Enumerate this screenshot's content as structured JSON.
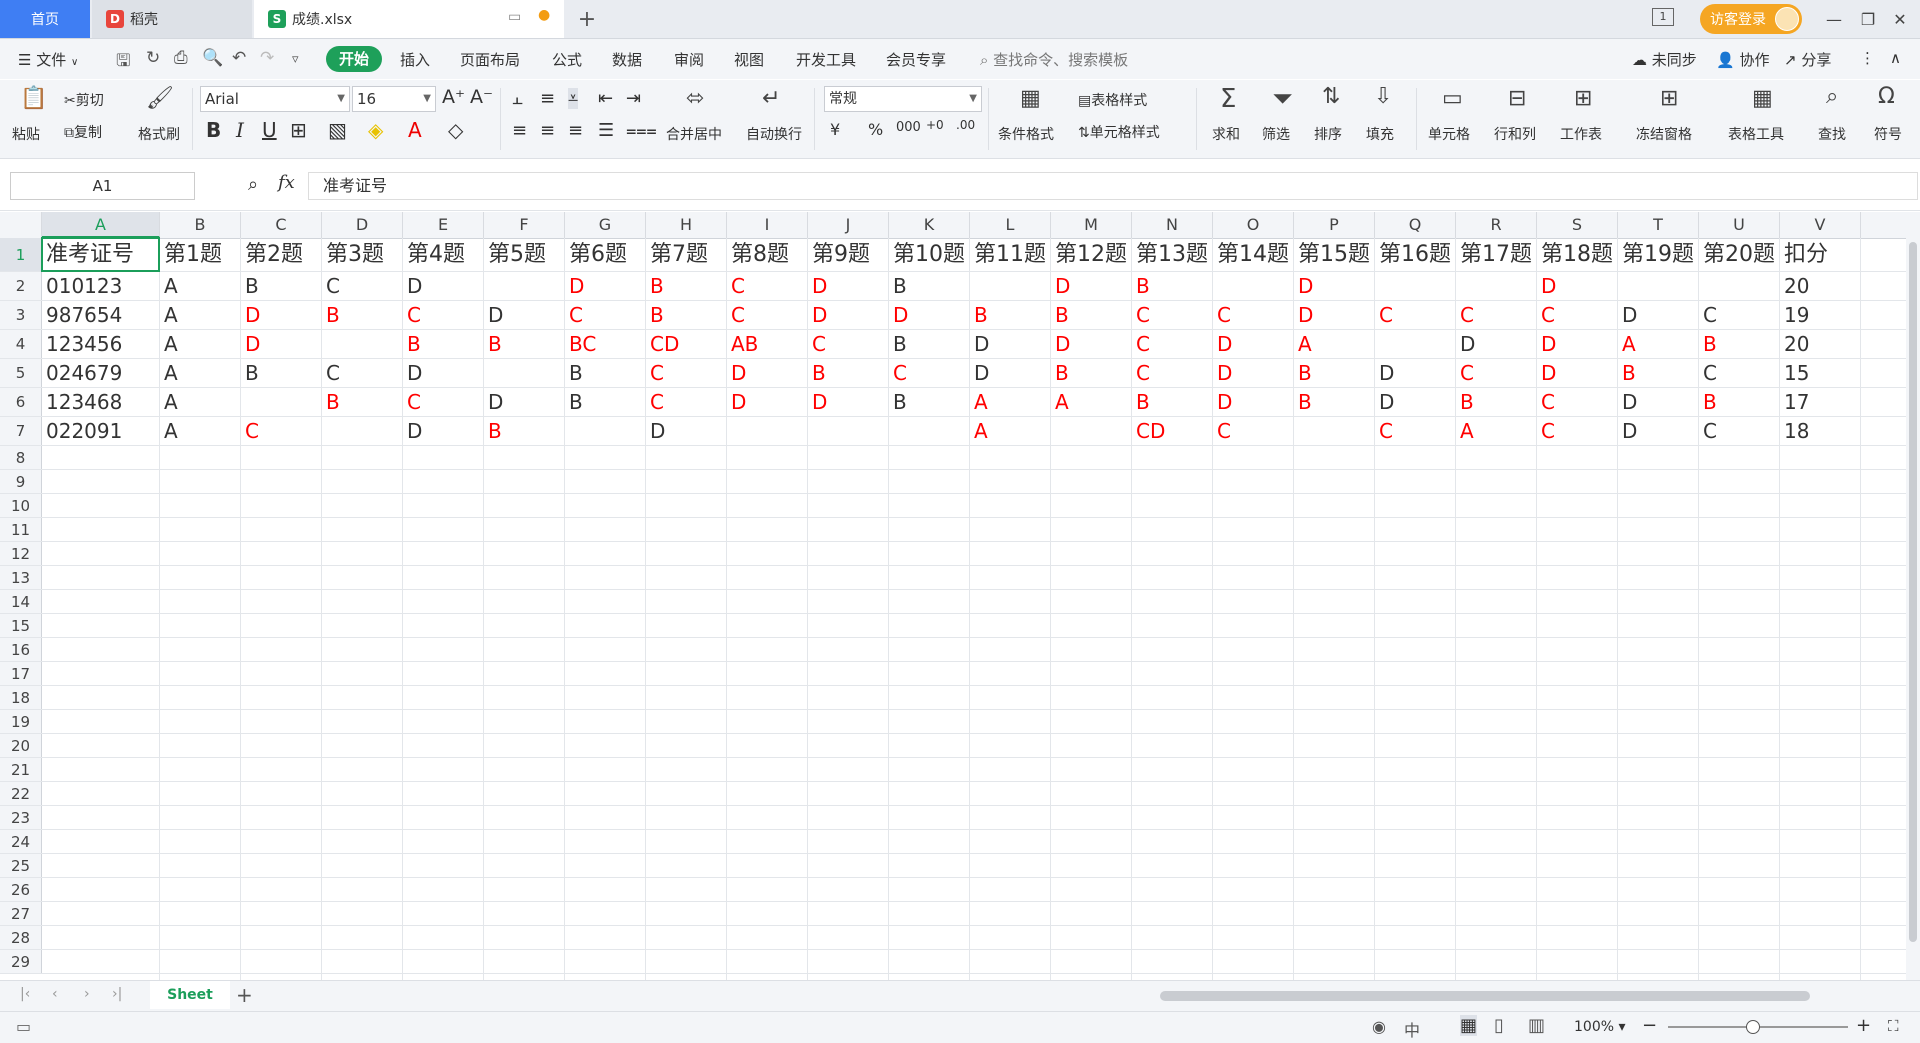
{
  "titlebar": {
    "tabs": [
      {
        "label": "首页"
      },
      {
        "label": "稻壳"
      },
      {
        "label": "成绩.xlsx"
      }
    ],
    "login": "访客登录",
    "page_indicator": "1"
  },
  "menubar": {
    "file": "文件",
    "items": [
      "开始",
      "插入",
      "页面布局",
      "公式",
      "数据",
      "审阅",
      "视图",
      "开发工具",
      "会员专享"
    ],
    "search_placeholder": "查找命令、搜索模板",
    "sync": "未同步",
    "collab": "协作",
    "share": "分享"
  },
  "toolbar": {
    "paste": "粘贴",
    "cut": "剪切",
    "copy": "复制",
    "format_painter": "格式刷",
    "font": "Arial",
    "size": "16",
    "merge_center": "合并居中",
    "wrap": "自动换行",
    "number_format": "常规",
    "cond_format": "条件格式",
    "table_style": "表格样式",
    "cell_style": "单元格样式",
    "sum": "求和",
    "filter": "筛选",
    "sort": "排序",
    "fill": "填充",
    "cell": "单元格",
    "rowcol": "行和列",
    "worksheet": "工作表",
    "freeze": "冻结窗格",
    "table_tools": "表格工具",
    "find": "查找",
    "symbol": "符号"
  },
  "formula_bar": {
    "name_box": "A1",
    "content": "准考证号"
  },
  "columns": [
    "A",
    "B",
    "C",
    "D",
    "E",
    "F",
    "G",
    "H",
    "I",
    "J",
    "K",
    "L",
    "M",
    "N",
    "O",
    "P",
    "Q",
    "R",
    "S",
    "T",
    "U",
    "V"
  ],
  "sheet": {
    "header": [
      "准考证号",
      "第1题",
      "第2题",
      "第3题",
      "第4题",
      "第5题",
      "第6题",
      "第7题",
      "第8题",
      "第9题",
      "第10题",
      "第11题",
      "第12题",
      "第13题",
      "第14题",
      "第15题",
      "第16题",
      "第17题",
      "第18题",
      "第19题",
      "第20题",
      "扣分"
    ],
    "rows": [
      [
        {
          "v": "010123"
        },
        {
          "v": "A"
        },
        {
          "v": "B"
        },
        {
          "v": "C"
        },
        {
          "v": "D"
        },
        {
          "v": ""
        },
        {
          "v": "D",
          "r": 1
        },
        {
          "v": "B",
          "r": 1
        },
        {
          "v": "C",
          "r": 1
        },
        {
          "v": "D",
          "r": 1
        },
        {
          "v": "B"
        },
        {
          "v": ""
        },
        {
          "v": "D",
          "r": 1
        },
        {
          "v": "B",
          "r": 1
        },
        {
          "v": ""
        },
        {
          "v": "D",
          "r": 1
        },
        {
          "v": ""
        },
        {
          "v": ""
        },
        {
          "v": "D",
          "r": 1
        },
        {
          "v": ""
        },
        {
          "v": ""
        },
        {
          "v": "20"
        }
      ],
      [
        {
          "v": "987654"
        },
        {
          "v": "A"
        },
        {
          "v": "D",
          "r": 1
        },
        {
          "v": "B",
          "r": 1
        },
        {
          "v": "C",
          "r": 1
        },
        {
          "v": "D"
        },
        {
          "v": "C",
          "r": 1
        },
        {
          "v": "B",
          "r": 1
        },
        {
          "v": "C",
          "r": 1
        },
        {
          "v": "D",
          "r": 1
        },
        {
          "v": "D",
          "r": 1
        },
        {
          "v": "B",
          "r": 1
        },
        {
          "v": "B",
          "r": 1
        },
        {
          "v": "C",
          "r": 1
        },
        {
          "v": "C",
          "r": 1
        },
        {
          "v": "D",
          "r": 1
        },
        {
          "v": "C",
          "r": 1
        },
        {
          "v": "C",
          "r": 1
        },
        {
          "v": "C",
          "r": 1
        },
        {
          "v": "D"
        },
        {
          "v": "C"
        },
        {
          "v": "19"
        }
      ],
      [
        {
          "v": "123456"
        },
        {
          "v": "A"
        },
        {
          "v": "D",
          "r": 1
        },
        {
          "v": ""
        },
        {
          "v": "B",
          "r": 1
        },
        {
          "v": "B",
          "r": 1
        },
        {
          "v": "BC",
          "r": 1
        },
        {
          "v": "CD",
          "r": 1
        },
        {
          "v": "AB",
          "r": 1
        },
        {
          "v": "C",
          "r": 1
        },
        {
          "v": "B"
        },
        {
          "v": "D"
        },
        {
          "v": "D",
          "r": 1
        },
        {
          "v": "C",
          "r": 1
        },
        {
          "v": "D",
          "r": 1
        },
        {
          "v": "A",
          "r": 1
        },
        {
          "v": ""
        },
        {
          "v": "D"
        },
        {
          "v": "D",
          "r": 1
        },
        {
          "v": "A",
          "r": 1
        },
        {
          "v": "B",
          "r": 1
        },
        {
          "v": "20"
        }
      ],
      [
        {
          "v": "024679"
        },
        {
          "v": "A"
        },
        {
          "v": "B"
        },
        {
          "v": "C"
        },
        {
          "v": "D"
        },
        {
          "v": ""
        },
        {
          "v": "B"
        },
        {
          "v": "C",
          "r": 1
        },
        {
          "v": "D",
          "r": 1
        },
        {
          "v": "B",
          "r": 1
        },
        {
          "v": "C",
          "r": 1
        },
        {
          "v": "D"
        },
        {
          "v": "B",
          "r": 1
        },
        {
          "v": "C",
          "r": 1
        },
        {
          "v": "D",
          "r": 1
        },
        {
          "v": "B",
          "r": 1
        },
        {
          "v": "D"
        },
        {
          "v": "C",
          "r": 1
        },
        {
          "v": "D",
          "r": 1
        },
        {
          "v": "B",
          "r": 1
        },
        {
          "v": "C"
        },
        {
          "v": "15"
        }
      ],
      [
        {
          "v": "123468"
        },
        {
          "v": "A"
        },
        {
          "v": ""
        },
        {
          "v": "B",
          "r": 1
        },
        {
          "v": "C",
          "r": 1
        },
        {
          "v": "D"
        },
        {
          "v": "B"
        },
        {
          "v": "C",
          "r": 1
        },
        {
          "v": "D",
          "r": 1
        },
        {
          "v": "D",
          "r": 1
        },
        {
          "v": "B"
        },
        {
          "v": "A",
          "r": 1
        },
        {
          "v": "A",
          "r": 1
        },
        {
          "v": "B",
          "r": 1
        },
        {
          "v": "D",
          "r": 1
        },
        {
          "v": "B",
          "r": 1
        },
        {
          "v": "D"
        },
        {
          "v": "B",
          "r": 1
        },
        {
          "v": "C",
          "r": 1
        },
        {
          "v": "D"
        },
        {
          "v": "B",
          "r": 1
        },
        {
          "v": "17"
        }
      ],
      [
        {
          "v": "022091"
        },
        {
          "v": "A"
        },
        {
          "v": "C",
          "r": 1
        },
        {
          "v": ""
        },
        {
          "v": "D"
        },
        {
          "v": "B",
          "r": 1
        },
        {
          "v": ""
        },
        {
          "v": "D"
        },
        {
          "v": ""
        },
        {
          "v": ""
        },
        {
          "v": ""
        },
        {
          "v": "A",
          "r": 1
        },
        {
          "v": ""
        },
        {
          "v": "CD",
          "r": 1
        },
        {
          "v": "C",
          "r": 1
        },
        {
          "v": ""
        },
        {
          "v": "C",
          "r": 1
        },
        {
          "v": "A",
          "r": 1
        },
        {
          "v": "C",
          "r": 1
        },
        {
          "v": "D"
        },
        {
          "v": "C"
        },
        {
          "v": "18"
        }
      ]
    ]
  },
  "row_numbers": [
    "1",
    "2",
    "3",
    "4",
    "5",
    "6",
    "7",
    "8",
    "9",
    "10",
    "11",
    "12",
    "13",
    "14",
    "15",
    "16",
    "17",
    "18",
    "19",
    "20",
    "21",
    "22",
    "23",
    "24",
    "25",
    "26",
    "27",
    "28",
    "29"
  ],
  "sheet_tabs": {
    "active": "Sheet"
  },
  "status": {
    "zoom": "100%"
  }
}
